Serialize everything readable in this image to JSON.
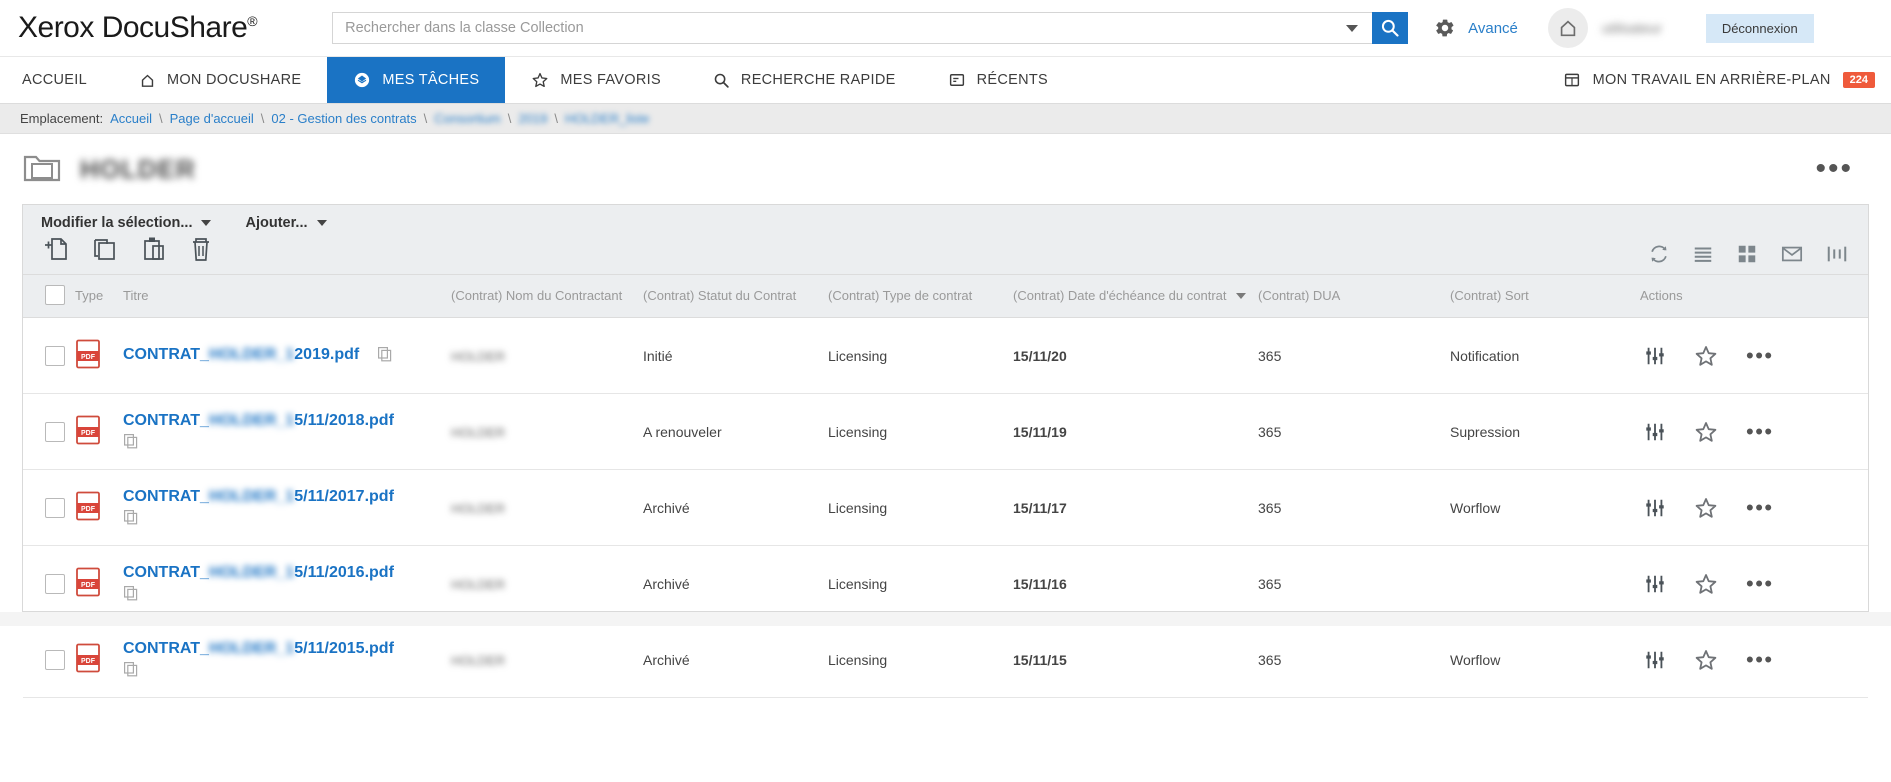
{
  "header": {
    "logo_text": "Xerox DocuShare",
    "logo_sup": "®",
    "search_placeholder": "Rechercher dans la classe Collection",
    "search_value": "",
    "advanced_label": "Avancé",
    "username": "utilisateur",
    "logout_label": "Déconnexion",
    "icons": {
      "dropdown": "chevron-down-icon",
      "search": "search-icon",
      "gear": "gear-icon",
      "home": "home-icon"
    }
  },
  "nav": {
    "items": [
      {
        "label": "ACCUEIL",
        "icon": "",
        "active": false
      },
      {
        "label": "MON DOCUSHARE",
        "icon": "home-icon",
        "active": false
      },
      {
        "label": "MES TÂCHES",
        "icon": "tasks-icon",
        "active": true
      },
      {
        "label": "MES FAVORIS",
        "icon": "star-icon",
        "active": false
      },
      {
        "label": "RECHERCHE RAPIDE",
        "icon": "search-icon",
        "active": false
      },
      {
        "label": "RÉCENTS",
        "icon": "document-icon",
        "active": false
      }
    ],
    "right": {
      "label": "MON TRAVAIL EN ARRIÈRE-PLAN",
      "icon": "calendar-icon",
      "badge": "224",
      "badge_color": "#ef5a3b"
    },
    "active_color": "#1a73c4"
  },
  "breadcrumb": {
    "label": "Emplacement:",
    "items": [
      {
        "text": "Accueil",
        "blurred": false
      },
      {
        "text": "Page d'accueil",
        "blurred": false
      },
      {
        "text": "02 - Gestion des contrats",
        "blurred": false
      },
      {
        "text": "Consortium",
        "blurred": true
      },
      {
        "text": "2019",
        "blurred": true
      },
      {
        "text": "HOLDER_liste",
        "blurred": true,
        "suffix": "iste"
      }
    ],
    "separator": "\\"
  },
  "folder": {
    "title": "HOLDER",
    "icon": "folder-icon",
    "menu_icon": "ellipsis-icon"
  },
  "toolbar": {
    "edit_selection_label": "Modifier la sélection...",
    "add_label": "Ajouter...",
    "left_icons": [
      "add-document-icon",
      "copy-icon",
      "paste-icon",
      "delete-icon"
    ],
    "right_icons": [
      "refresh-icon",
      "list-view-icon",
      "grid-view-icon",
      "mail-icon",
      "split-view-icon"
    ]
  },
  "table": {
    "columns": [
      "",
      "Type",
      "Titre",
      "(Contrat) Nom du Contractant",
      "(Contrat) Statut du Contrat",
      "(Contrat) Type de contrat",
      "(Contrat) Date d'échéance du contrat",
      "(Contrat) DUA",
      "(Contrat) Sort",
      "Actions"
    ],
    "sorted_column_index": 6,
    "sort_direction": "desc",
    "rows": [
      {
        "type_icon": "pdf-icon",
        "title_prefix": "CONTRAT_",
        "title_blur": "HOLDER_1",
        "title_suffix": "2019.pdf",
        "contractant": "HOLDER",
        "statut": "Initié",
        "type_contrat": "Licensing",
        "date_echeance": "15/11/20",
        "dua": "365",
        "sort": "Notification",
        "copy_inline": true
      },
      {
        "type_icon": "pdf-icon",
        "title_prefix": "CONTRAT_",
        "title_blur": "HOLDER_1",
        "title_suffix": "5/11/2018.pdf",
        "contractant": "HOLDER",
        "statut": "A renouveler",
        "type_contrat": "Licensing",
        "date_echeance": "15/11/19",
        "dua": "365",
        "sort": "Supression",
        "copy_inline": false
      },
      {
        "type_icon": "pdf-icon",
        "title_prefix": "CONTRAT_",
        "title_blur": "HOLDER_1",
        "title_suffix": "5/11/2017.pdf",
        "contractant": "HOLDER",
        "statut": "Archivé",
        "type_contrat": "Licensing",
        "date_echeance": "15/11/17",
        "dua": "365",
        "sort": "Worflow",
        "copy_inline": false
      },
      {
        "type_icon": "pdf-icon",
        "title_prefix": "CONTRAT_",
        "title_blur": "HOLDER_1",
        "title_suffix": "5/11/2016.pdf",
        "contractant": "HOLDER",
        "statut": "Archivé",
        "type_contrat": "Licensing",
        "date_echeance": "15/11/16",
        "dua": "365",
        "sort": "",
        "copy_inline": false
      },
      {
        "type_icon": "pdf-icon",
        "title_prefix": "CONTRAT_",
        "title_blur": "HOLDER_1",
        "title_suffix": "5/11/2015.pdf",
        "contractant": "HOLDER",
        "statut": "Archivé",
        "type_contrat": "Licensing",
        "date_echeance": "15/11/15",
        "dua": "365",
        "sort": "Worflow",
        "copy_inline": false
      }
    ],
    "row_action_icons": [
      "properties-icon",
      "star-icon",
      "ellipsis-icon"
    ]
  },
  "colors": {
    "accent": "#1a73c4",
    "link": "#2a7fc9",
    "badge": "#ef5a3b",
    "toolbar_bg": "#eceef0",
    "breadcrumb_bg": "#ebebeb"
  }
}
